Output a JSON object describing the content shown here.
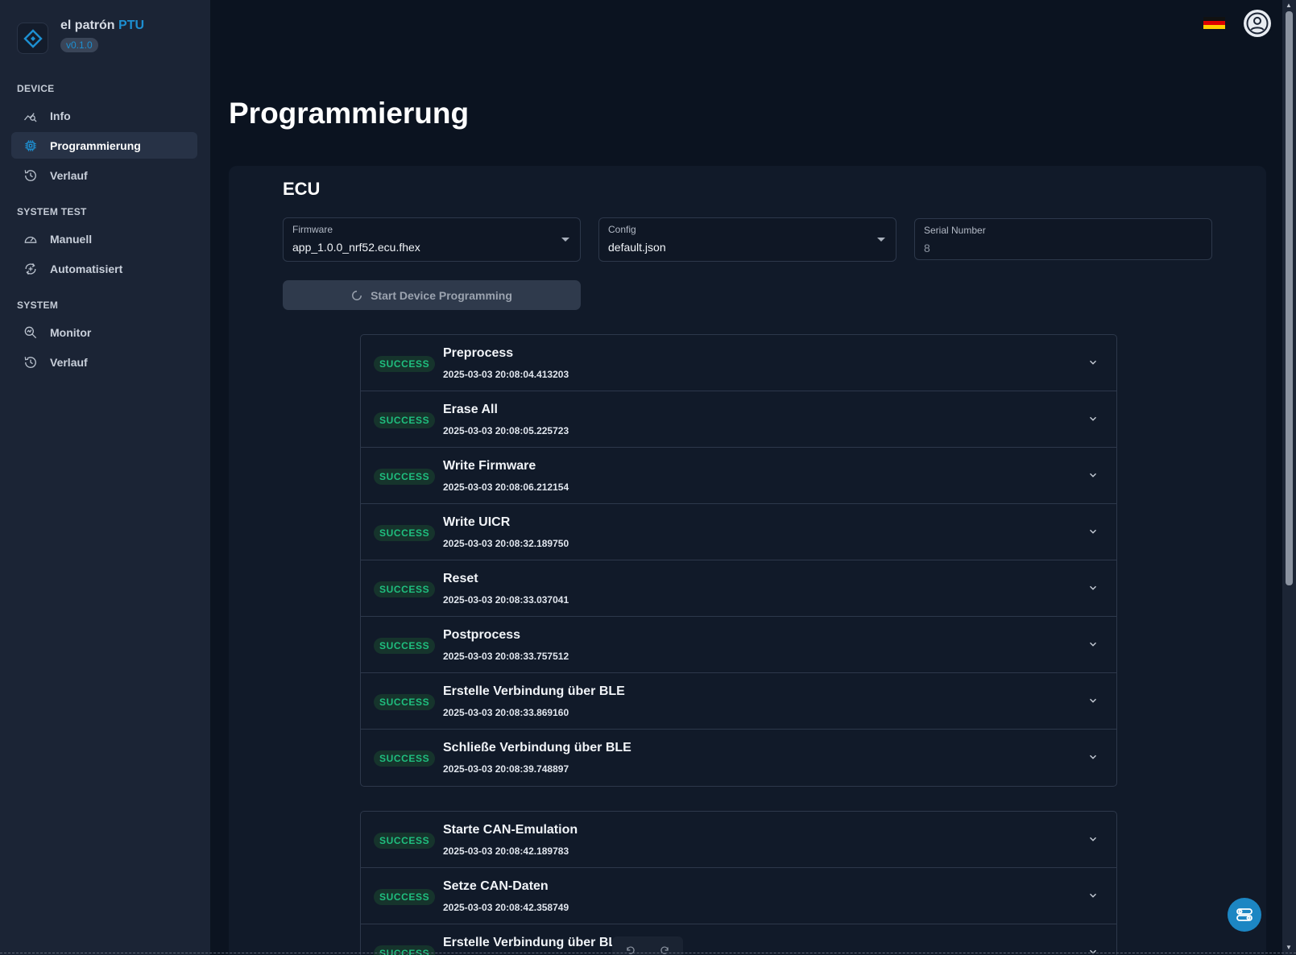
{
  "brand": {
    "name": "el patrón",
    "accent": "PTU",
    "version": "v0.1.0"
  },
  "sidebar": {
    "sections": [
      {
        "title": "DEVICE"
      },
      {
        "title": "SYSTEM TEST"
      },
      {
        "title": "SYSTEM"
      }
    ],
    "items": [
      {
        "label": "Info",
        "icon": "chart-search-icon"
      },
      {
        "label": "Programmierung",
        "icon": "chip-icon",
        "active": true
      },
      {
        "label": "Verlauf",
        "icon": "history-icon"
      },
      {
        "label": "Manuell",
        "icon": "gauge-icon"
      },
      {
        "label": "Automatisiert",
        "icon": "auto-refresh-icon"
      },
      {
        "label": "Monitor",
        "icon": "zoom-monitor-icon"
      },
      {
        "label": "Verlauf",
        "icon": "history-icon"
      }
    ]
  },
  "header": {
    "language_flag": "german-flag-icon",
    "user": "account-icon"
  },
  "page": {
    "title": "Programmierung"
  },
  "ecu": {
    "title": "ECU",
    "firmware": {
      "label": "Firmware",
      "value": "app_1.0.0_nrf52.ecu.fhex"
    },
    "config": {
      "label": "Config",
      "value": "default.json"
    },
    "serial": {
      "label": "Serial Number",
      "value": "8"
    },
    "start_button": "Start Device Programming"
  },
  "steps_group1": [
    {
      "status": "SUCCESS",
      "name": "Preprocess",
      "time": "2025-03-03 20:08:04.413203"
    },
    {
      "status": "SUCCESS",
      "name": "Erase All",
      "time": "2025-03-03 20:08:05.225723"
    },
    {
      "status": "SUCCESS",
      "name": "Write Firmware",
      "time": "2025-03-03 20:08:06.212154"
    },
    {
      "status": "SUCCESS",
      "name": "Write UICR",
      "time": "2025-03-03 20:08:32.189750"
    },
    {
      "status": "SUCCESS",
      "name": "Reset",
      "time": "2025-03-03 20:08:33.037041"
    },
    {
      "status": "SUCCESS",
      "name": "Postprocess",
      "time": "2025-03-03 20:08:33.757512"
    },
    {
      "status": "SUCCESS",
      "name": "Erstelle Verbindung über BLE",
      "time": "2025-03-03 20:08:33.869160"
    },
    {
      "status": "SUCCESS",
      "name": "Schließe Verbindung über BLE",
      "time": "2025-03-03 20:08:39.748897"
    }
  ],
  "steps_group2": [
    {
      "status": "SUCCESS",
      "name": "Starte CAN-Emulation",
      "time": "2025-03-03 20:08:42.189783"
    },
    {
      "status": "SUCCESS",
      "name": "Setze CAN-Daten",
      "time": "2025-03-03 20:08:42.358749"
    },
    {
      "status": "SUCCESS",
      "name": "Erstelle Verbindung über BLE",
      "time": ""
    }
  ],
  "colors": {
    "background": "#0b1320",
    "sidebar": "#1b2435",
    "accent": "#1d8fd1",
    "success_text": "#1fbf7f",
    "success_bg": "#16342c"
  }
}
